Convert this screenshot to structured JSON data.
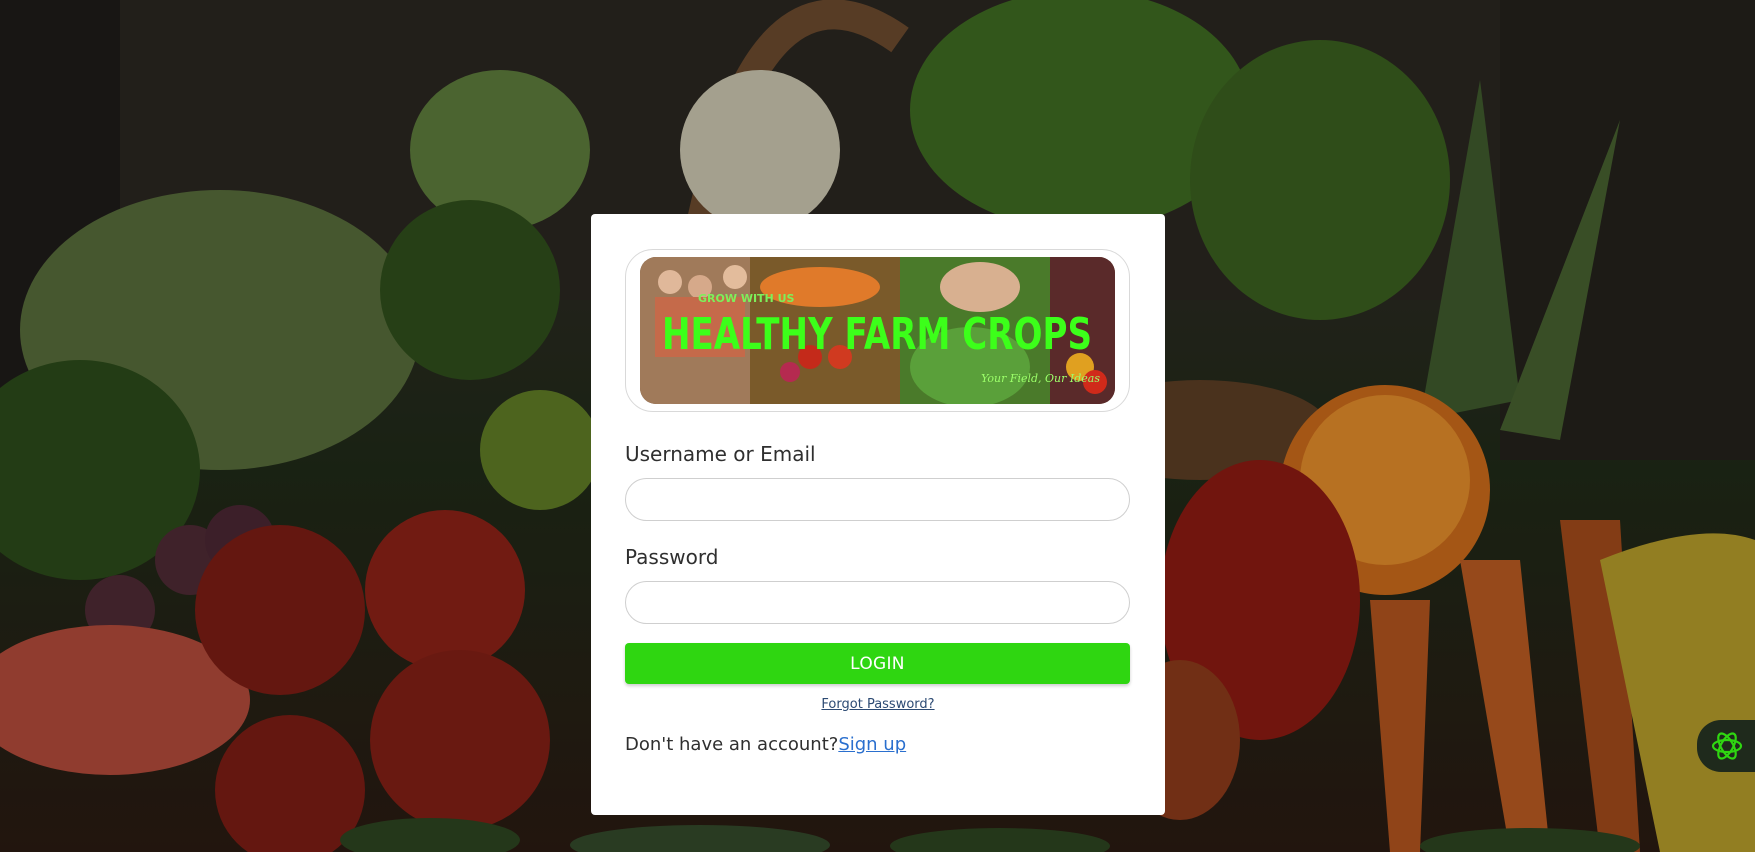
{
  "banner": {
    "tagline": "GROW WITH US",
    "title": "HEALTHY FARM CROPS",
    "subtitle": "Your Field, Our Ideas"
  },
  "form": {
    "username_label": "Username or Email",
    "username_value": "",
    "password_label": "Password",
    "password_value": "",
    "login_label": "LOGIN",
    "forgot_label": "Forgot Password?",
    "no_account_text": "Don't have an account?",
    "signup_label": "Sign up"
  },
  "colors": {
    "accent": "#2fd611",
    "link": "#2a6fce",
    "assistant_icon": "#2fd611"
  },
  "icons": {
    "assistant": "ai-assistant-icon"
  }
}
